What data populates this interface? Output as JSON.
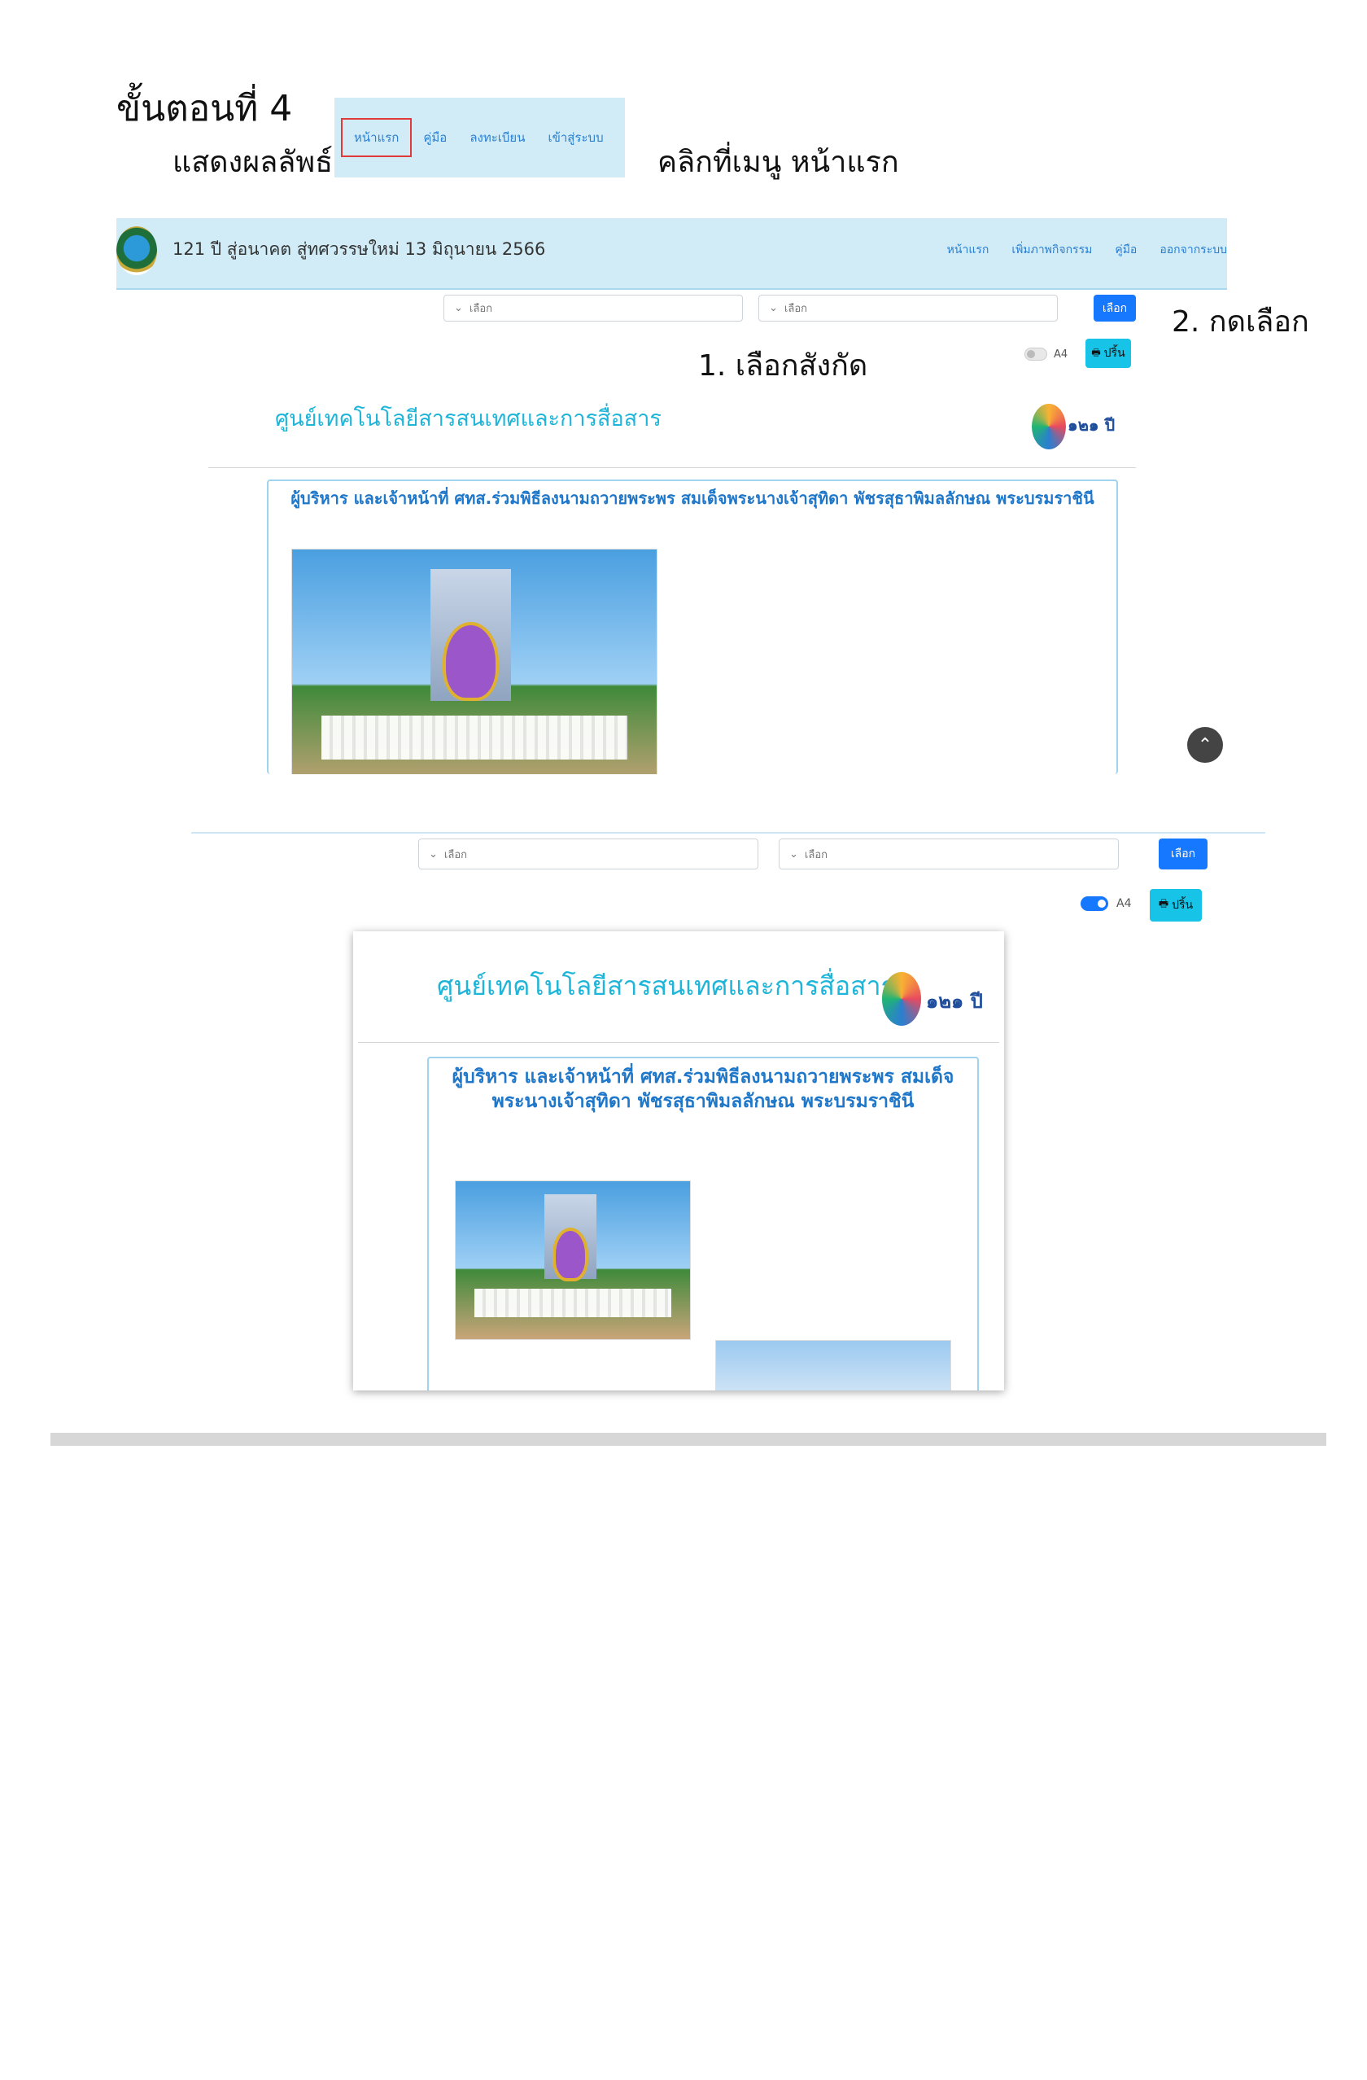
{
  "heading": {
    "step": "ขั้นตอนที่ 4",
    "result": "แสดงผลลัพธ์",
    "click_instruction": "คลิกที่เมนู หน้าแรก"
  },
  "mini_nav": {
    "items": [
      "หน้าแรก",
      "คู่มือ",
      "ลงทะเบียน",
      "เข้าสู่ระบบ"
    ]
  },
  "app_bar": {
    "title": "121 ปี สู่อนาคต สู่ทศวรรษใหม่ 13 มิถุนายน 2566",
    "nav": [
      "หน้าแรก",
      "เพิ่มภาพกิจกรรม",
      "คู่มือ",
      "ออกจากระบบ"
    ]
  },
  "filters": {
    "select1_value": "เลือก",
    "select2_value": "เลือก",
    "select_button": "เลือก",
    "toggle_label": "A4",
    "print_button": "ปริ้น",
    "a4_enabled_first": false,
    "a4_enabled_second": true
  },
  "notes": {
    "step1": "1. เลือกสังกัด",
    "step2": "2. กดเลือก"
  },
  "report": {
    "org_name": "ศูนย์เทคโนโลยีสารสนเทศและการสื่อสาร",
    "logo_text": "๑๒๑ ปี",
    "title_single": "ผู้บริหาร และเจ้าหน้าที่ ศทส.ร่วมพิธีลงนามถวายพระพร สมเด็จพระนางเจ้าสุทิดา พัชรสุธาพิมลลักษณ พระบรมราชินี",
    "title_line1": "ผู้บริหาร และเจ้าหน้าที่ ศทส.ร่วมพิธีลงนามถวายพระพร สมเด็จ",
    "title_line2": "พระนางเจ้าสุทิดา พัชรสุธาพิมลลักษณ พระบรมราชินี"
  },
  "icons": [
    "seal-logo-icon",
    "chevron-down-icon",
    "printer-icon",
    "chevron-up-icon",
    "anniversary-logo-icon"
  ],
  "colors": {
    "nav_bg": "#d1ecf7",
    "link": "#2a7fd0",
    "primary": "#1677ff",
    "info": "#17c3e6",
    "org_name": "#1fb5d8",
    "highlight": "#e03a3a"
  }
}
